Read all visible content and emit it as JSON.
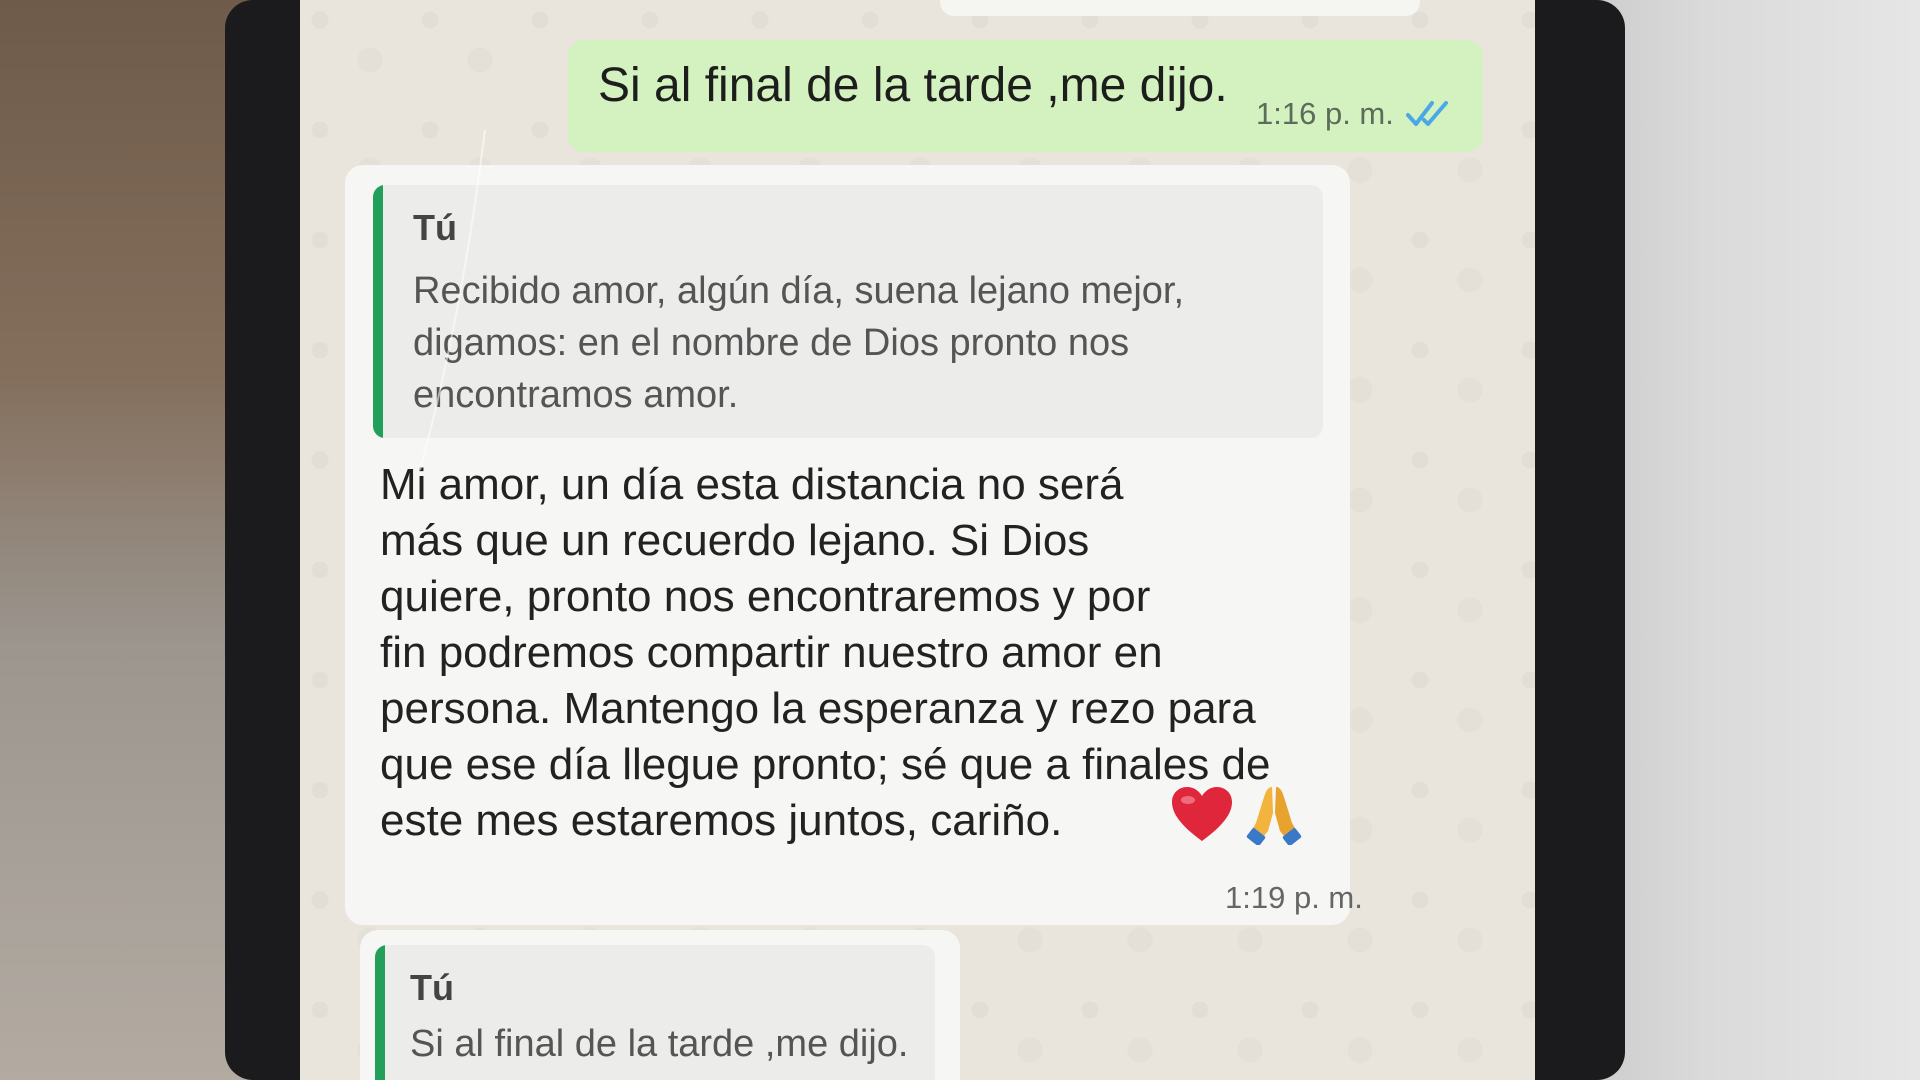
{
  "chat": {
    "outgoing": {
      "text": "Si al final de la tarde ,me dijo.",
      "time": "1:16 p. m.",
      "status_icon": "double-check-read-icon"
    },
    "incoming": {
      "quote_author": "Tú",
      "quote_text": "Recibido amor, algún día, suena lejano mejor,\ndigamos: en el nombre de Dios pronto nos\nencontramos  amor.",
      "body": "Mi amor, un día esta distancia no será\nmás que un recuerdo lejano. Si Dios\nquiere, pronto nos encontraremos y por\nfin podremos compartir nuestro amor en\npersona. Mantengo la esperanza y rezo para\nque ese día llegue pronto; sé que a finales de\neste mes estaremos juntos, cariño.",
      "emojis": [
        "red-heart-emoji",
        "folded-hands-emoji"
      ],
      "time": "1:19 p. m."
    },
    "reply_preview": {
      "quote_author": "Tú",
      "quote_text": "Si al final de la tarde ,me dijo."
    }
  },
  "colors": {
    "outgoing_bubble": "#d4f2bf",
    "incoming_bubble": "#f6f6f4",
    "quote_bar": "#22a05a",
    "read_check": "#4aa8e8"
  }
}
